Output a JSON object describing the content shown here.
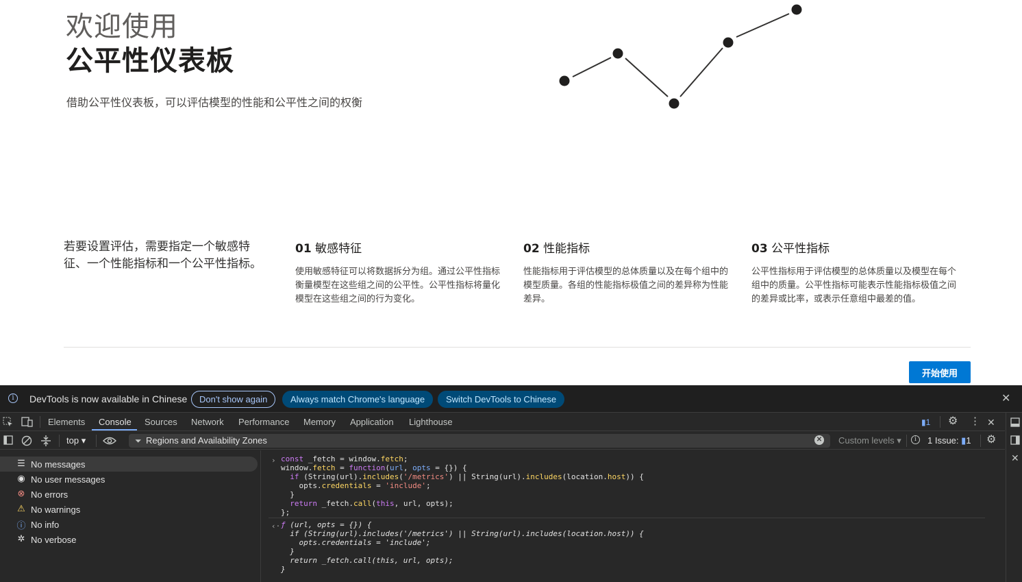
{
  "page": {
    "welcome_light": "欢迎使用",
    "welcome_bold": "公平性仪表板",
    "subtitle": "借助公平性仪表板，可以评估模型的性能和公平性之间的权衡",
    "intro": "若要设置评估，需要指定一个敏感特征、一个性能指标和一个公平性指标。",
    "steps": [
      {
        "num": "01",
        "title": "敏感特征",
        "text": "使用敏感特征可以将数据拆分为组。通过公平性指标衡量模型在这些组之间的公平性。公平性指标将量化模型在这些组之间的行为变化。"
      },
      {
        "num": "02",
        "title": "性能指标",
        "text": "性能指标用于评估模型的总体质量以及在每个组中的模型质量。各组的性能指标极值之间的差异称为性能差异。"
      },
      {
        "num": "03",
        "title": "公平性指标",
        "text": "公平性指标用于评估模型的总体质量以及模型在每个组中的质量。公平性指标可能表示性能指标极值之间的差异或比率，或表示任意组中最差的值。"
      }
    ],
    "start_button": "开始使用",
    "accent_color": "#0078d4"
  },
  "devtools": {
    "infobar": {
      "message": "DevTools is now available in Chinese",
      "dont_show": "Don't show again",
      "always_match": "Always match Chrome's language",
      "switch": "Switch DevTools to Chinese"
    },
    "tabs": [
      "Elements",
      "Console",
      "Sources",
      "Network",
      "Performance",
      "Memory",
      "Application",
      "Lighthouse"
    ],
    "active_tab": "Console",
    "issues_badge": "1",
    "context": "top",
    "filter_value": "Regions and Availability Zones",
    "levels": "Custom levels",
    "issues_label": "1 Issue:",
    "issues_count": "1",
    "sidebar": [
      {
        "icon": "list-icon",
        "label": "No messages"
      },
      {
        "icon": "user-icon",
        "label": "No user messages"
      },
      {
        "icon": "error-icon",
        "label": "No errors"
      },
      {
        "icon": "warning-icon",
        "label": "No warnings"
      },
      {
        "icon": "info-icon",
        "label": "No info"
      },
      {
        "icon": "bug-icon",
        "label": "No verbose"
      }
    ]
  }
}
